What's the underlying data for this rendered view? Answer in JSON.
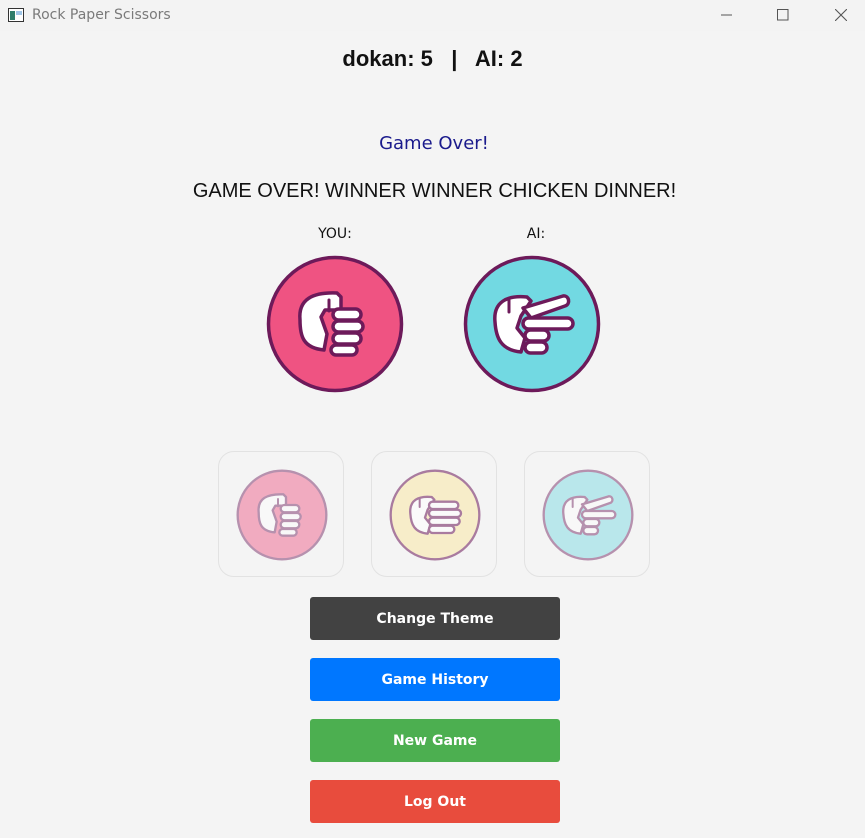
{
  "window": {
    "title": "Rock Paper Scissors",
    "icons": [
      "app-icon",
      "minimize-icon",
      "maximize-icon",
      "close-icon"
    ]
  },
  "score": {
    "text": "dokan: 5   |   AI: 2",
    "player_name": "dokan",
    "player_score": 5,
    "ai_name": "AI",
    "ai_score": 2
  },
  "status": "Game Over!",
  "message": "GAME OVER! WINNER WINNER CHICKEN DINNER!",
  "labels": {
    "you": "YOU:",
    "ai": "AI:"
  },
  "result": {
    "you_choice": "rock-hand-icon",
    "ai_choice": "scissors-hand-icon"
  },
  "choices": [
    "rock-hand-icon",
    "paper-hand-icon",
    "scissors-hand-icon"
  ],
  "colors": {
    "rock": "#ef5382",
    "paper": "#fbe9a6",
    "scissors": "#72d9e2",
    "outline": "#6d1a5a"
  },
  "buttons": {
    "change_theme": "Change Theme",
    "game_history": "Game History",
    "new_game": "New Game",
    "log_out": "Log Out"
  }
}
